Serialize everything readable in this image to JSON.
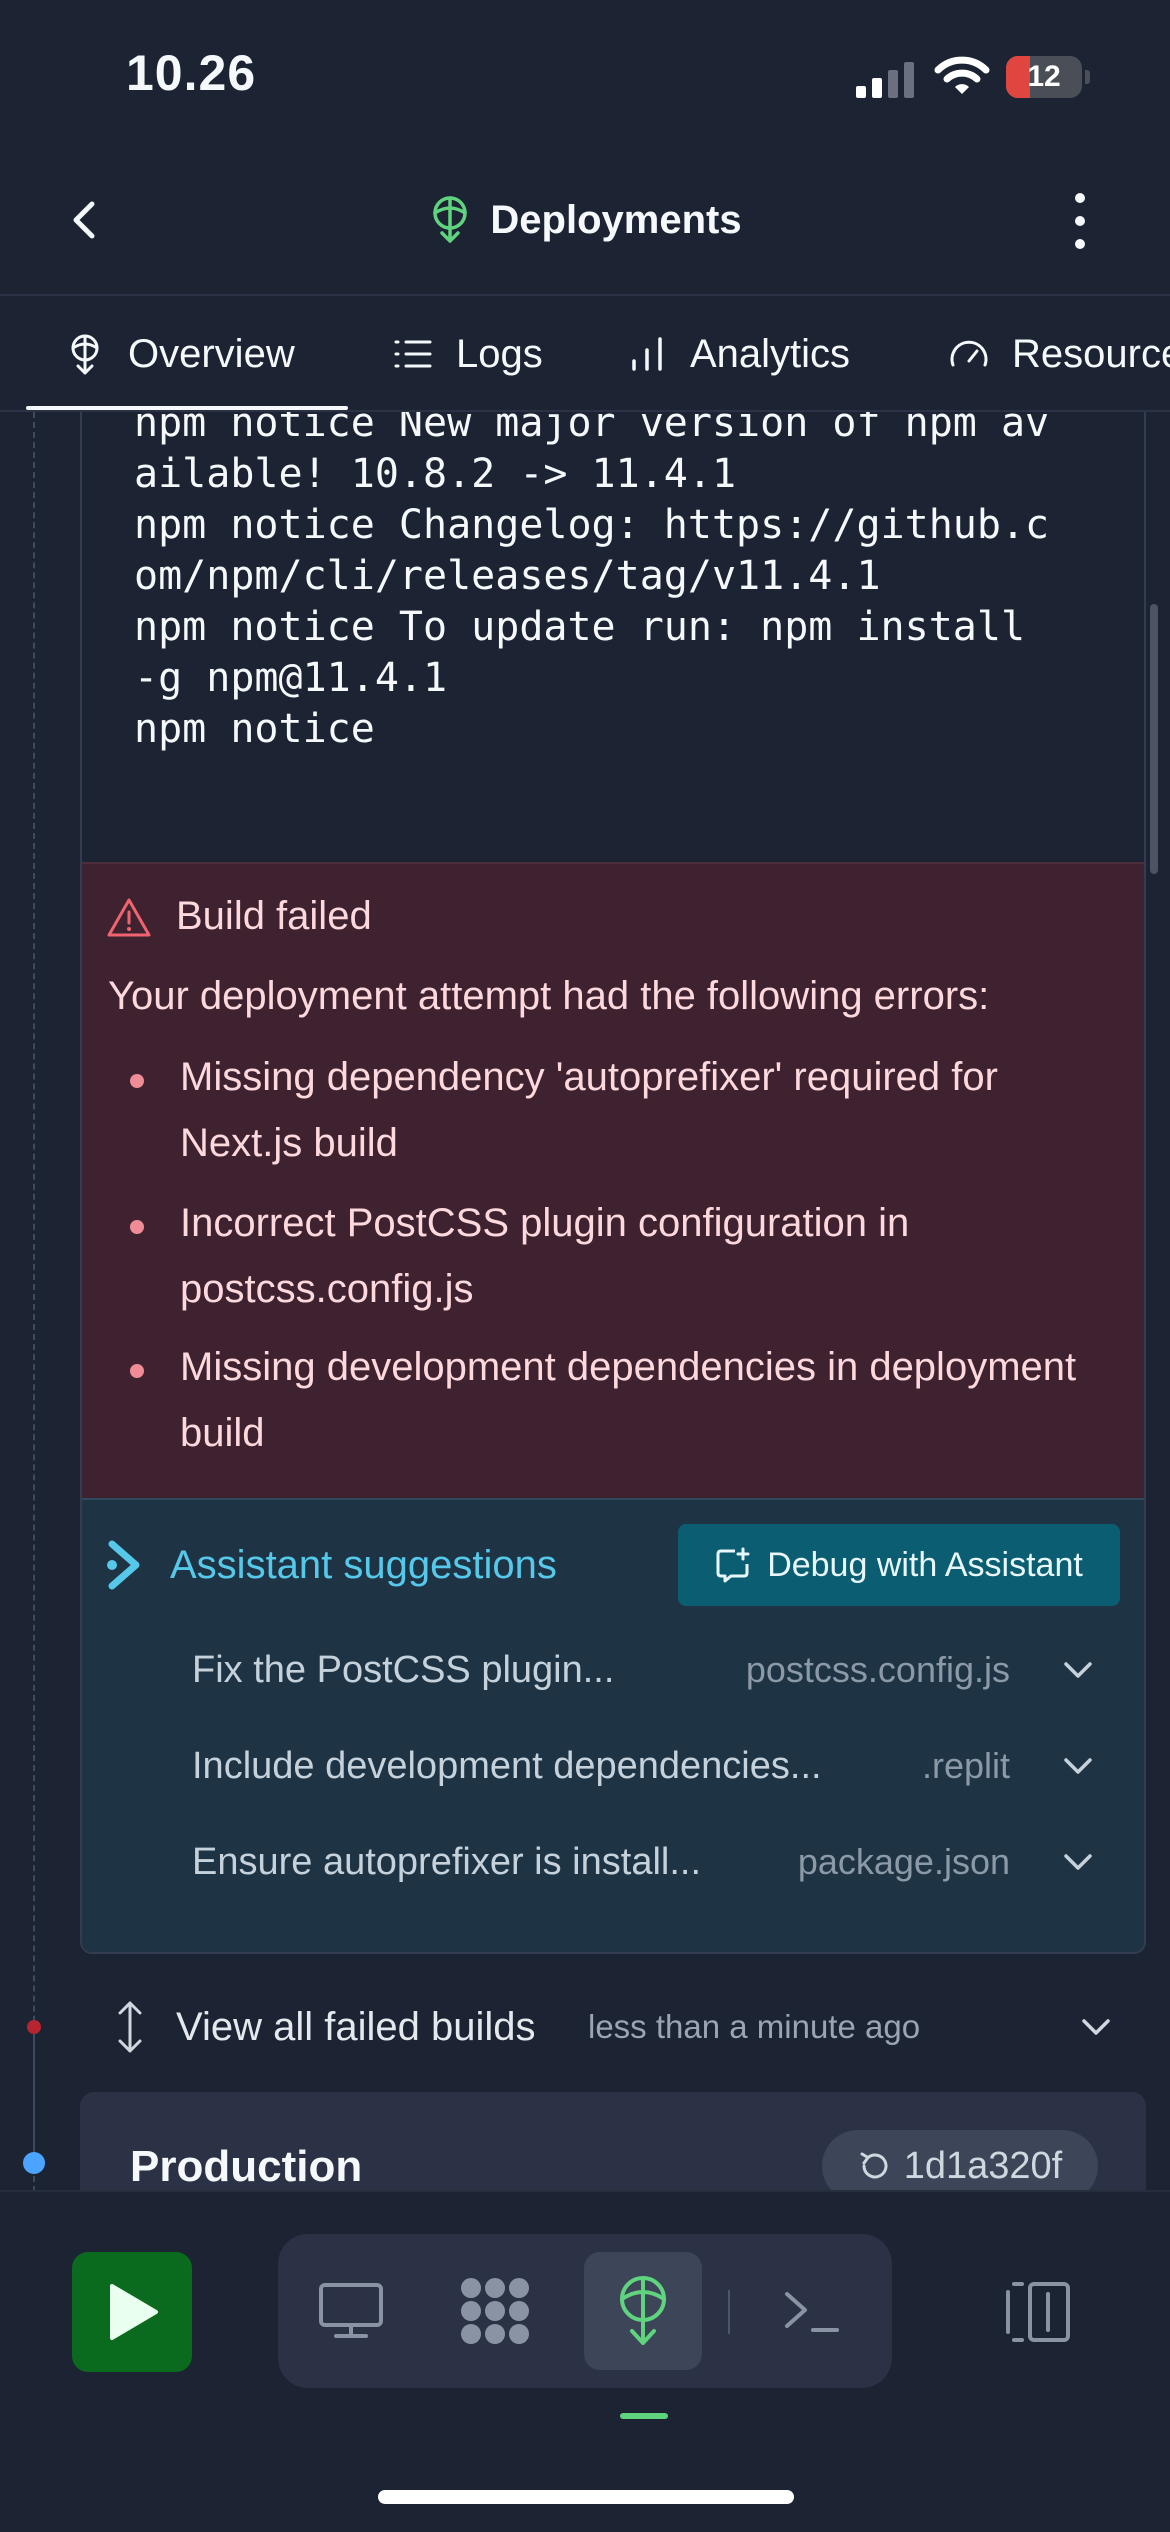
{
  "status_bar": {
    "time": "10.26",
    "battery": "12"
  },
  "header": {
    "title": "Deployments"
  },
  "tabs": [
    {
      "label": "Overview",
      "icon": "deployments-icon"
    },
    {
      "label": "Logs",
      "icon": "list-icon"
    },
    {
      "label": "Analytics",
      "icon": "bar-chart-icon"
    },
    {
      "label": "Resources",
      "icon": "gauge-icon"
    }
  ],
  "log_lines": [
    "npm notice New major version of npm av",
    "ailable! 10.8.2 -> 11.4.1",
    "npm notice Changelog: https://github.c",
    "om/npm/cli/releases/tag/v11.4.1",
    "npm notice To update run: npm install",
    "-g npm@11.4.1",
    "npm notice"
  ],
  "error": {
    "title": "Build failed",
    "intro": "Your deployment attempt had the following errors:",
    "items": [
      "Missing dependency 'autoprefixer' required for Next.js build",
      "Incorrect PostCSS plugin configuration in postcss.config.js",
      "Missing development dependencies in deployment build"
    ]
  },
  "assistant": {
    "title": "Assistant suggestions",
    "debug_label": "Debug with Assistant",
    "suggestions": [
      {
        "text": "Fix the PostCSS plugin...",
        "file": "postcss.config.js"
      },
      {
        "text": "Include development dependencies...",
        "file": ".replit"
      },
      {
        "text": "Ensure autoprefixer is install...",
        "file": "package.json"
      }
    ]
  },
  "failed_builds": {
    "label": "View all failed builds",
    "time": "less than a minute ago"
  },
  "production": {
    "title": "Production",
    "commit": "1d1a320f"
  },
  "dock": {
    "items": [
      "preview-icon",
      "workspace-icon",
      "deployments-icon",
      "shell-icon"
    ],
    "active": "deployments-icon"
  },
  "colors": {
    "background": "#1c2333",
    "accent_green": "#5fd37e",
    "error_bg": "#3f2230",
    "assistant_cyan": "#56c8ea",
    "run_green": "#0a6b1e"
  }
}
